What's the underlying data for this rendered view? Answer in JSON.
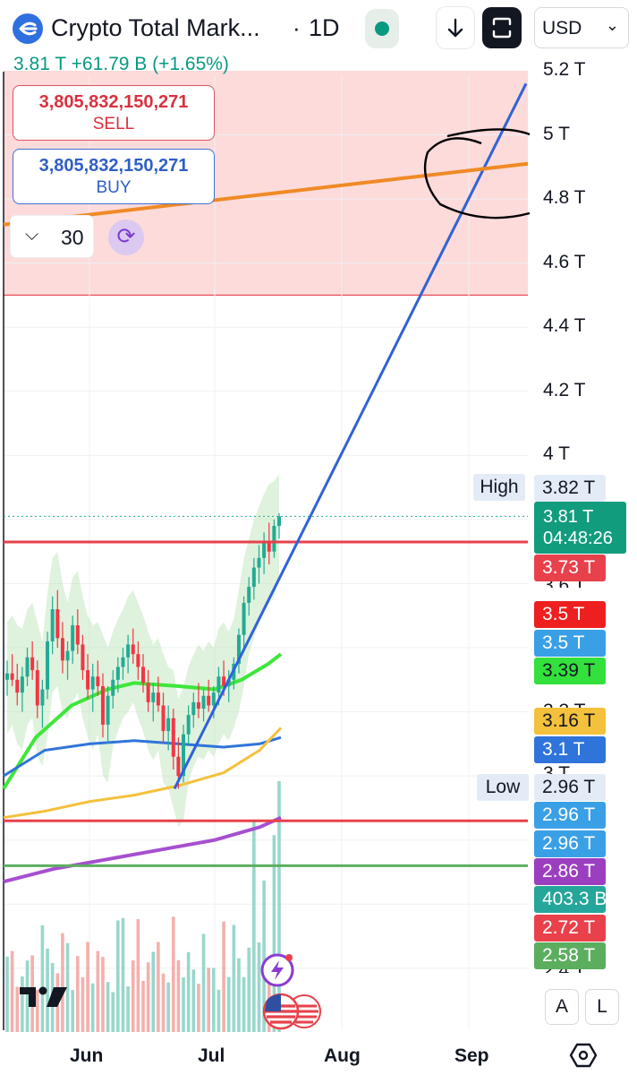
{
  "header": {
    "symbol": "Crypto Total Mark...",
    "separator": "·",
    "interval": "1D",
    "last": "3.81 T",
    "change": "+61.79 B",
    "change_pct": "(+1.65%)",
    "currency": "USD"
  },
  "trade": {
    "sell_price": "3,805,832,150,271",
    "sell_label": "SELL",
    "buy_price": "3,805,832,150,271",
    "buy_label": "BUY",
    "quantity": "30"
  },
  "price_axis": {
    "ticks": [
      "5.2 T",
      "5 T",
      "4.8 T",
      "4.6 T",
      "4.4 T",
      "4.2 T",
      "4 T"
    ],
    "partial_ticks": [
      "3.6 T",
      "3.3 T",
      "3 T",
      "2.4 T"
    ],
    "high_label": "High",
    "high_value": "3.82 T",
    "low_label": "Low",
    "low_value": "2.96 T",
    "current_value": "3.81 T",
    "countdown": "04:48:26",
    "tags": [
      {
        "text": "3.73 T",
        "color": "#e8414b"
      },
      {
        "text": "3.5 T",
        "color": "#ee1f1f"
      },
      {
        "text": "3.5 T",
        "color": "#3aa0e6"
      },
      {
        "text": "3.39 T",
        "color": "#33e03c"
      },
      {
        "text": "3.16 T",
        "color": "#f4c13d"
      },
      {
        "text": "3.1 T",
        "color": "#2f74da"
      },
      {
        "text": "2.96 T",
        "color": "#3aa0e6"
      },
      {
        "text": "2.96 T",
        "color": "#3aa0e6"
      },
      {
        "text": "2.86 T",
        "color": "#9b3fc0"
      },
      {
        "text": "403.3 B",
        "color": "#26a69a"
      },
      {
        "text": "2.72 T",
        "color": "#e8414b"
      },
      {
        "text": "2.58 T",
        "color": "#5cae5f"
      }
    ]
  },
  "time_axis": {
    "labels": [
      "Jun",
      "Jul",
      "Aug",
      "Sep"
    ]
  },
  "controls": {
    "auto_label": "A",
    "log_label": "L"
  },
  "chart_data": {
    "type": "candlestick",
    "price_ylim": [
      2.4,
      5.2
    ],
    "unit": "T USD",
    "x_labels": [
      "Jun",
      "Jul",
      "Aug",
      "Sep"
    ],
    "candles_ohlc": [
      [
        3.3,
        3.36,
        3.25,
        3.32
      ],
      [
        3.32,
        3.38,
        3.28,
        3.3
      ],
      [
        3.3,
        3.35,
        3.22,
        3.26
      ],
      [
        3.26,
        3.34,
        3.2,
        3.31
      ],
      [
        3.31,
        3.4,
        3.28,
        3.37
      ],
      [
        3.37,
        3.42,
        3.3,
        3.33
      ],
      [
        3.33,
        3.36,
        3.18,
        3.22
      ],
      [
        3.22,
        3.3,
        3.15,
        3.27
      ],
      [
        3.27,
        3.45,
        3.24,
        3.42
      ],
      [
        3.42,
        3.56,
        3.38,
        3.52
      ],
      [
        3.52,
        3.58,
        3.4,
        3.43
      ],
      [
        3.43,
        3.48,
        3.32,
        3.36
      ],
      [
        3.36,
        3.42,
        3.3,
        3.39
      ],
      [
        3.39,
        3.5,
        3.35,
        3.47
      ],
      [
        3.47,
        3.52,
        3.38,
        3.41
      ],
      [
        3.41,
        3.44,
        3.3,
        3.33
      ],
      [
        3.33,
        3.38,
        3.24,
        3.27
      ],
      [
        3.27,
        3.35,
        3.2,
        3.31
      ],
      [
        3.31,
        3.36,
        3.25,
        3.28
      ],
      [
        3.28,
        3.32,
        3.12,
        3.16
      ],
      [
        3.16,
        3.28,
        3.1,
        3.25
      ],
      [
        3.25,
        3.33,
        3.21,
        3.3
      ],
      [
        3.3,
        3.37,
        3.26,
        3.34
      ],
      [
        3.34,
        3.4,
        3.3,
        3.37
      ],
      [
        3.37,
        3.44,
        3.32,
        3.41
      ],
      [
        3.41,
        3.46,
        3.35,
        3.38
      ],
      [
        3.38,
        3.42,
        3.3,
        3.34
      ],
      [
        3.34,
        3.38,
        3.26,
        3.29
      ],
      [
        3.29,
        3.33,
        3.2,
        3.23
      ],
      [
        3.23,
        3.29,
        3.17,
        3.26
      ],
      [
        3.26,
        3.31,
        3.2,
        3.22
      ],
      [
        3.22,
        3.26,
        3.1,
        3.14
      ],
      [
        3.14,
        3.22,
        3.08,
        3.18
      ],
      [
        3.18,
        3.21,
        3.02,
        3.06
      ],
      [
        3.06,
        3.12,
        2.96,
        3.0
      ],
      [
        3.0,
        3.16,
        2.98,
        3.13
      ],
      [
        3.13,
        3.22,
        3.1,
        3.19
      ],
      [
        3.19,
        3.26,
        3.15,
        3.23
      ],
      [
        3.23,
        3.29,
        3.18,
        3.21
      ],
      [
        3.21,
        3.27,
        3.17,
        3.25
      ],
      [
        3.25,
        3.3,
        3.2,
        3.22
      ],
      [
        3.22,
        3.28,
        3.18,
        3.26
      ],
      [
        3.26,
        3.34,
        3.22,
        3.31
      ],
      [
        3.31,
        3.36,
        3.25,
        3.28
      ],
      [
        3.28,
        3.33,
        3.23,
        3.3
      ],
      [
        3.3,
        3.37,
        3.27,
        3.35
      ],
      [
        3.35,
        3.46,
        3.32,
        3.44
      ],
      [
        3.44,
        3.56,
        3.4,
        3.54
      ],
      [
        3.54,
        3.62,
        3.5,
        3.59
      ],
      [
        3.59,
        3.68,
        3.55,
        3.65
      ],
      [
        3.65,
        3.72,
        3.6,
        3.68
      ],
      [
        3.68,
        3.76,
        3.63,
        3.73
      ],
      [
        3.73,
        3.79,
        3.66,
        3.7
      ],
      [
        3.7,
        3.8,
        3.68,
        3.78
      ],
      [
        3.78,
        3.82,
        3.74,
        3.81
      ]
    ],
    "levels": [
      {
        "value": 3.73,
        "color": "#e8414b"
      },
      {
        "value": 2.86,
        "color": "#e8414b"
      },
      {
        "value": 2.72,
        "color": "#5cae5f"
      }
    ],
    "zone": {
      "from": 4.5,
      "to": 5.2,
      "color": "#fcd5d3"
    },
    "trendline_blue": [
      [
        2.96,
        0.34
      ],
      [
        5.16,
        1.0
      ]
    ],
    "trendline_orange": [
      [
        4.72,
        0.0
      ],
      [
        4.91,
        1.0
      ]
    ],
    "volume_ref": "403.3 B"
  }
}
